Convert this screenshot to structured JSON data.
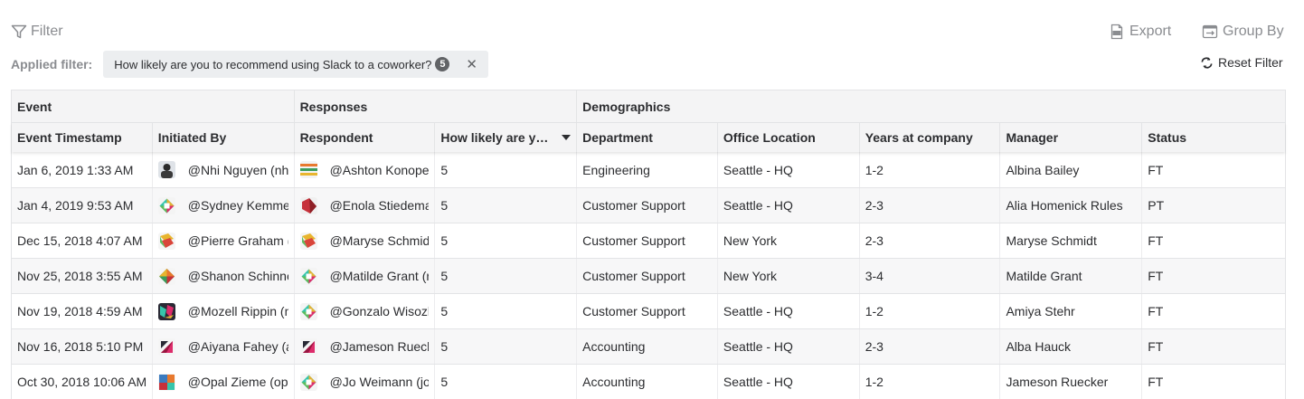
{
  "toolbar": {
    "filter_label": "Filter",
    "applied_label": "Applied filter:",
    "chip_text": "How likely are you to recommend using Slack to a coworker?",
    "chip_count": "5",
    "chip_close": "✕",
    "export_label": "Export",
    "groupby_label": "Group By",
    "reset_label": "Reset Filter"
  },
  "table": {
    "groups": [
      "Event",
      "Responses",
      "Demographics"
    ],
    "columns": [
      "Event Timestamp",
      "Initiated By",
      "Respondent",
      "How likely are y…",
      "Department",
      "Office Location",
      "Years at company",
      "Manager",
      "Status"
    ],
    "rows": [
      {
        "ts": "Jan 6, 2019 1:33 AM",
        "initiator": "@Nhi Nguyen (nhi",
        "ia": "photo",
        "respondent": "@Ashton Konopel",
        "ra": "stripes",
        "score": "5",
        "dept": "Engineering",
        "office": "Seattle - HQ",
        "years": "1-2",
        "manager": "Albina Bailey",
        "status": "FT"
      },
      {
        "ts": "Jan 4, 2019 9:53 AM",
        "initiator": "@Sydney Kemme",
        "ia": "slack",
        "respondent": "@Enola Stiedema",
        "ra": "red",
        "score": "5",
        "dept": "Customer Support",
        "office": "Seattle - HQ",
        "years": "2-3",
        "manager": "Alia Homenick Rules",
        "status": "PT"
      },
      {
        "ts": "Dec 15, 2018 4:07 AM",
        "initiator": "@Pierre Graham (",
        "ia": "warm",
        "respondent": "@Maryse Schmidt",
        "ra": "warm",
        "score": "5",
        "dept": "Customer Support",
        "office": "New York",
        "years": "2-3",
        "manager": "Maryse Schmidt",
        "status": "FT"
      },
      {
        "ts": "Nov 25, 2018 3:55 AM",
        "initiator": "@Shanon Schinne",
        "ia": "multi",
        "respondent": "@Matilde Grant (r",
        "ra": "slack",
        "score": "5",
        "dept": "Customer Support",
        "office": "New York",
        "years": "3-4",
        "manager": "Matilde Grant",
        "status": "FT"
      },
      {
        "ts": "Nov 19, 2018 4:59 AM",
        "initiator": "@Mozell Rippin (n",
        "ia": "dark",
        "respondent": "@Gonzalo Wisozk",
        "ra": "slack",
        "score": "5",
        "dept": "Customer Support",
        "office": "Seattle - HQ",
        "years": "1-2",
        "manager": "Amiya Stehr",
        "status": "FT"
      },
      {
        "ts": "Nov 16, 2018 5:10 PM",
        "initiator": "@Aiyana Fahey (a",
        "ia": "pink",
        "respondent": "@Jameson Rueck",
        "ra": "pink",
        "score": "5",
        "dept": "Accounting",
        "office": "Seattle - HQ",
        "years": "2-3",
        "manager": "Alba Hauck",
        "status": "FT"
      },
      {
        "ts": "Oct 30, 2018 10:06 AM",
        "initiator": "@Opal Zieme (op",
        "ia": "blocks",
        "respondent": "@Jo Weimann (jo",
        "ra": "slack",
        "score": "5",
        "dept": "Accounting",
        "office": "Seattle - HQ",
        "years": "1-2",
        "manager": "Jameson Ruecker",
        "status": "FT"
      }
    ]
  }
}
